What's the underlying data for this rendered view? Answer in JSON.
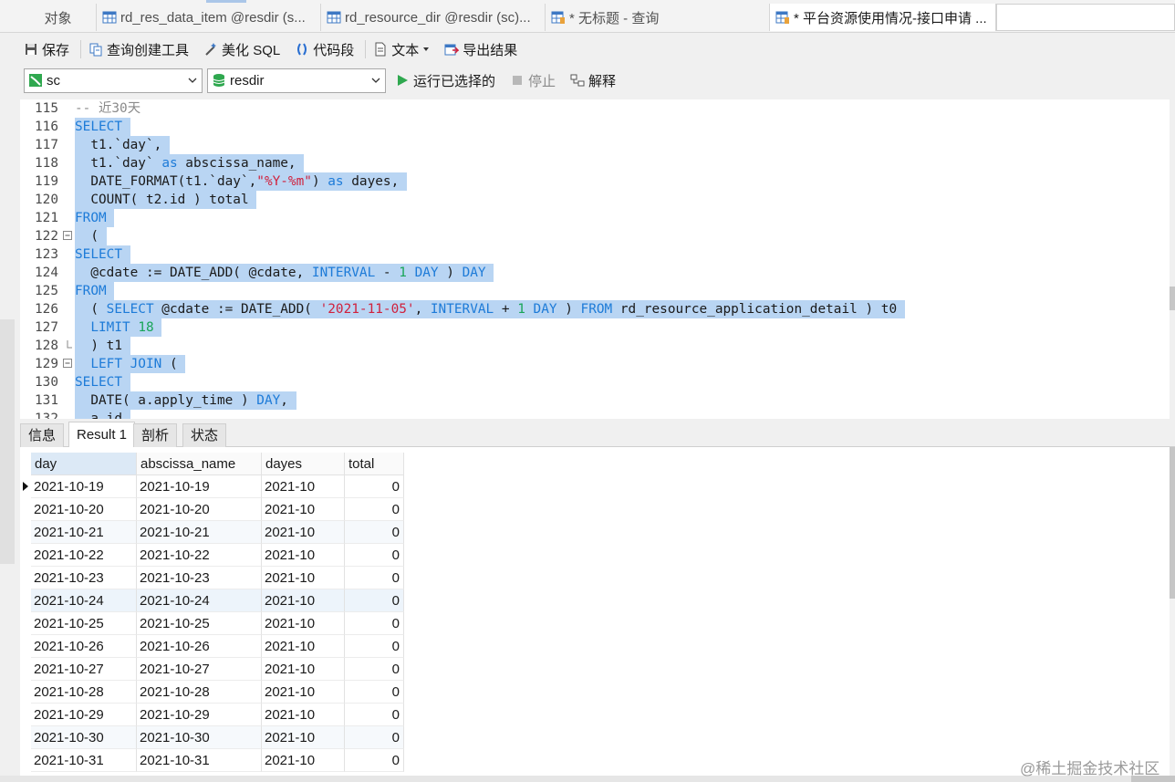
{
  "tabs": [
    {
      "label": "对象",
      "icon": "none"
    },
    {
      "label": "rd_res_data_item @resdir (s...",
      "icon": "table-icon"
    },
    {
      "label": "rd_resource_dir @resdir (sc)...",
      "icon": "table-icon"
    },
    {
      "label": "* 无标题 - 查询",
      "icon": "query-icon"
    },
    {
      "label": "* 平台资源使用情况-接口申请 ...",
      "icon": "query-icon"
    }
  ],
  "toolbar": {
    "save": "保存",
    "query_builder": "查询创建工具",
    "beautify_sql": "美化 SQL",
    "code_snippet": "代码段",
    "text": "文本",
    "export": "导出结果"
  },
  "connection": {
    "connection": "sc",
    "database": "resdir",
    "run_selected": "运行已选择的",
    "stop": "停止",
    "explain": "解释"
  },
  "editor_lines": [
    {
      "n": "115",
      "t": [
        [
          "cmt",
          "-- 近30天"
        ]
      ]
    },
    {
      "n": "116",
      "t": [
        [
          "kw",
          "SELECT"
        ],
        [
          "",
          " "
        ]
      ]
    },
    {
      "n": "117",
      "t": [
        [
          "",
          "  t1.`day`, "
        ]
      ]
    },
    {
      "n": "118",
      "t": [
        [
          "",
          "  t1.`day` "
        ],
        [
          "kw",
          "as"
        ],
        [
          "",
          " abscissa_name, "
        ]
      ]
    },
    {
      "n": "119",
      "t": [
        [
          "",
          "  DATE_FORMAT(t1.`day`,"
        ],
        [
          "str",
          "\"%Y-%m\""
        ],
        [
          "",
          ") "
        ],
        [
          "kw",
          "as"
        ],
        [
          "",
          " dayes, "
        ]
      ]
    },
    {
      "n": "120",
      "t": [
        [
          "",
          "  COUNT( t2.id ) total "
        ]
      ]
    },
    {
      "n": "121",
      "t": [
        [
          "kw",
          "FROM"
        ],
        [
          "",
          " "
        ]
      ]
    },
    {
      "n": "122",
      "t": [
        [
          "",
          "  ( "
        ]
      ]
    },
    {
      "n": "123",
      "t": [
        [
          "kw",
          "SELECT"
        ],
        [
          "",
          " "
        ]
      ]
    },
    {
      "n": "124",
      "t": [
        [
          "",
          "  @cdate := DATE_ADD( @cdate, "
        ],
        [
          "kw",
          "INTERVAL"
        ],
        [
          "",
          " - "
        ],
        [
          "num",
          "1"
        ],
        [
          "",
          " "
        ],
        [
          "kw",
          "DAY"
        ],
        [
          "",
          " ) "
        ],
        [
          "kw",
          "DAY"
        ],
        [
          "",
          " "
        ]
      ]
    },
    {
      "n": "125",
      "t": [
        [
          "kw",
          "FROM"
        ],
        [
          "",
          " "
        ]
      ]
    },
    {
      "n": "126",
      "t": [
        [
          "",
          "  ( "
        ],
        [
          "kw",
          "SELECT"
        ],
        [
          "",
          " @cdate := DATE_ADD( "
        ],
        [
          "str",
          "'2021-11-05'"
        ],
        [
          "",
          ", "
        ],
        [
          "kw",
          "INTERVAL"
        ],
        [
          "",
          " + "
        ],
        [
          "num",
          "1"
        ],
        [
          "",
          " "
        ],
        [
          "kw",
          "DAY"
        ],
        [
          "",
          " ) "
        ],
        [
          "kw",
          "FROM"
        ],
        [
          "",
          " rd_resource_application_detail ) t0 "
        ]
      ]
    },
    {
      "n": "127",
      "t": [
        [
          "",
          "  "
        ],
        [
          "kw",
          "LIMIT"
        ],
        [
          "",
          " "
        ],
        [
          "num",
          "18"
        ],
        [
          "",
          " "
        ]
      ]
    },
    {
      "n": "128",
      "t": [
        [
          "",
          "  ) t1 "
        ]
      ]
    },
    {
      "n": "129",
      "t": [
        [
          "",
          "  "
        ],
        [
          "kw",
          "LEFT JOIN"
        ],
        [
          "",
          " ( "
        ]
      ]
    },
    {
      "n": "130",
      "t": [
        [
          "kw",
          "SELECT"
        ],
        [
          "",
          " "
        ]
      ]
    },
    {
      "n": "131",
      "t": [
        [
          "",
          "  DATE( a.apply_time ) "
        ],
        [
          "kw",
          "DAY"
        ],
        [
          "",
          ", "
        ]
      ]
    },
    {
      "n": "132",
      "t": [
        [
          "",
          "  a.id "
        ]
      ]
    }
  ],
  "result_tabs": [
    "信息",
    "Result 1",
    "剖析",
    "状态"
  ],
  "grid": {
    "columns": [
      "day",
      "abscissa_name",
      "dayes",
      "total"
    ],
    "rows": [
      [
        "2021-10-19",
        "2021-10-19",
        "2021-10",
        "0"
      ],
      [
        "2021-10-20",
        "2021-10-20",
        "2021-10",
        "0"
      ],
      [
        "2021-10-21",
        "2021-10-21",
        "2021-10",
        "0"
      ],
      [
        "2021-10-22",
        "2021-10-22",
        "2021-10",
        "0"
      ],
      [
        "2021-10-23",
        "2021-10-23",
        "2021-10",
        "0"
      ],
      [
        "2021-10-24",
        "2021-10-24",
        "2021-10",
        "0"
      ],
      [
        "2021-10-25",
        "2021-10-25",
        "2021-10",
        "0"
      ],
      [
        "2021-10-26",
        "2021-10-26",
        "2021-10",
        "0"
      ],
      [
        "2021-10-27",
        "2021-10-27",
        "2021-10",
        "0"
      ],
      [
        "2021-10-28",
        "2021-10-28",
        "2021-10",
        "0"
      ],
      [
        "2021-10-29",
        "2021-10-29",
        "2021-10",
        "0"
      ],
      [
        "2021-10-30",
        "2021-10-30",
        "2021-10",
        "0"
      ],
      [
        "2021-10-31",
        "2021-10-31",
        "2021-10",
        "0"
      ]
    ]
  },
  "watermark": "@稀土掘金技术社区",
  "colors": {
    "keyword": "#1d7bd8",
    "string": "#d0213d",
    "number": "#18a558",
    "selection": "#b9d5f3",
    "run_green": "#2fa84f"
  }
}
